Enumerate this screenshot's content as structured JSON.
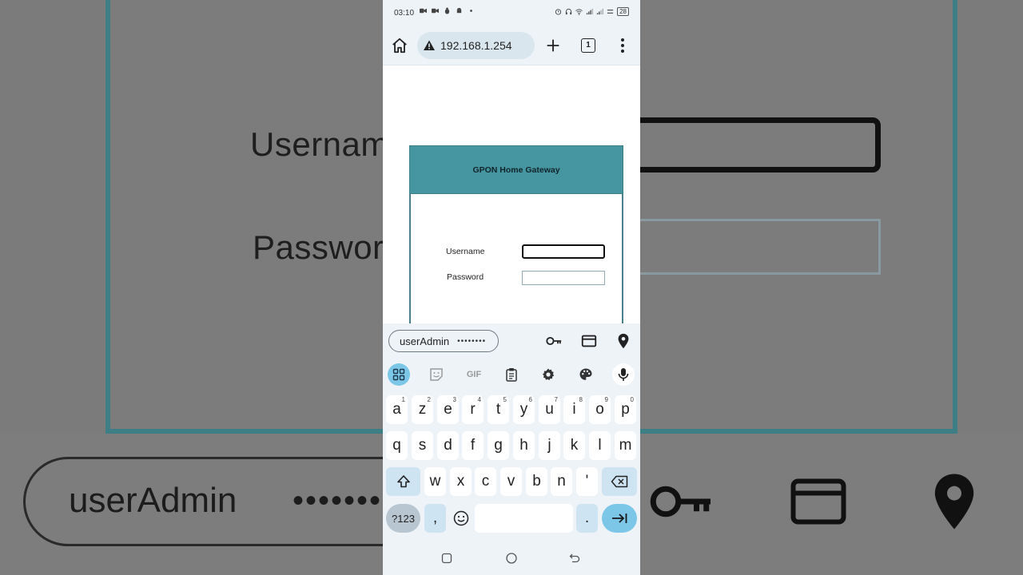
{
  "status": {
    "time": "03:10",
    "battery": "28"
  },
  "browser": {
    "url": "192.168.1.254",
    "tab_count": "1"
  },
  "page": {
    "title": "GPON Home Gateway",
    "username_label": "Username",
    "password_label": "Password",
    "username_value": "",
    "password_value": ""
  },
  "autofill": {
    "suggestion_user": "userAdmin",
    "suggestion_pass": "••••••••"
  },
  "keyboard": {
    "gif_label": "GIF",
    "row1": [
      {
        "k": "a",
        "s": "1"
      },
      {
        "k": "z",
        "s": "2"
      },
      {
        "k": "e",
        "s": "3"
      },
      {
        "k": "r",
        "s": "4"
      },
      {
        "k": "t",
        "s": "5"
      },
      {
        "k": "y",
        "s": "6"
      },
      {
        "k": "u",
        "s": "7"
      },
      {
        "k": "i",
        "s": "8"
      },
      {
        "k": "o",
        "s": "9"
      },
      {
        "k": "p",
        "s": "0"
      }
    ],
    "row2": [
      "q",
      "s",
      "d",
      "f",
      "g",
      "h",
      "j",
      "k",
      "l",
      "m"
    ],
    "row3": [
      "w",
      "x",
      "c",
      "v",
      "b",
      "n",
      "'"
    ],
    "symbols_label": "?123",
    "comma_label": ",",
    "period_label": "."
  },
  "background": {
    "username_label": "Usernam",
    "password_label": "Passwor",
    "pill_user": "userAdmin",
    "pill_dots": "•••••••"
  },
  "colors": {
    "header": "#4696a2",
    "accent": "#7cc6e8"
  }
}
